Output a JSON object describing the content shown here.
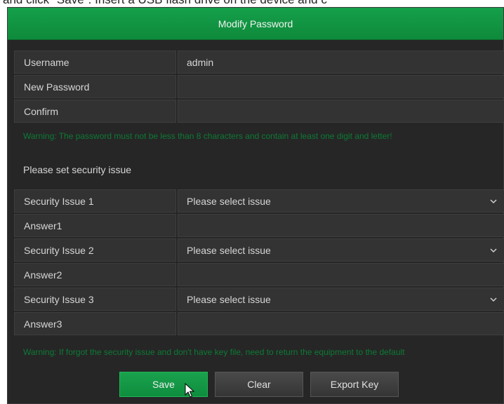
{
  "header_text": "and click \"Save\". Insert a USB flash drive on the device and c",
  "dialog": {
    "title": "Modify Password"
  },
  "fields": {
    "username_label": "Username",
    "username_value": "admin",
    "new_password_label": "New Password",
    "confirm_label": "Confirm"
  },
  "warning1": "Warning: The password must not be less than 8 characters and contain at least one digit and letter!",
  "security_title": "Please set security issue",
  "security": [
    {
      "issue_label": "Security Issue 1",
      "issue_value": "Please select issue",
      "answer_label": "Answer1"
    },
    {
      "issue_label": "Security Issue 2",
      "issue_value": "Please select issue",
      "answer_label": "Answer2"
    },
    {
      "issue_label": "Security Issue 3",
      "issue_value": "Please select issue",
      "answer_label": "Answer3"
    }
  ],
  "warning2": "Warning: If forgot the security issue and don't have key file, need to return the equipment to the default",
  "buttons": {
    "save": "Save",
    "clear": "Clear",
    "export_key": "Export Key"
  },
  "colors": {
    "accent_green": "#0e8d3e",
    "warning_green": "#0d7a35",
    "panel": "#262626"
  }
}
